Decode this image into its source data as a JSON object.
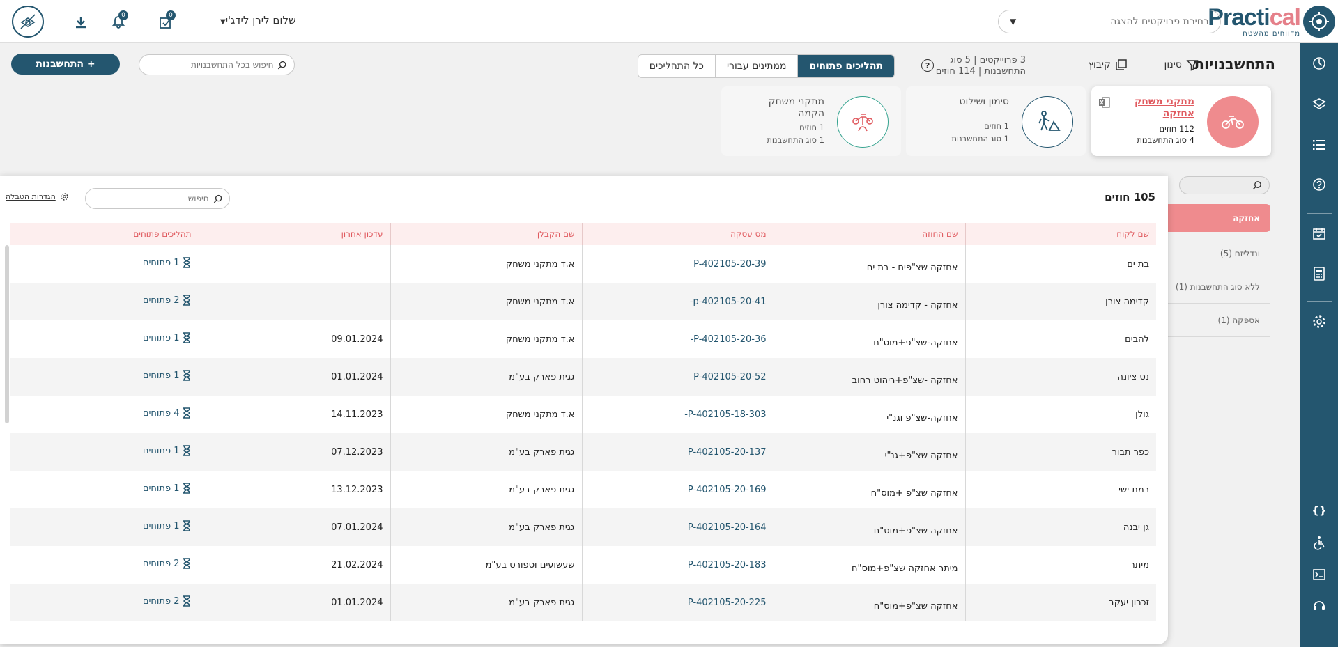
{
  "topbar": {
    "logo_word_main": "Practi",
    "logo_word_accent": "cal",
    "logo_sub": "מדווחים מהשטח",
    "project_select_placeholder": "בחירת פרויקטים להצגה",
    "greeting": "שלום לירן לידג'י",
    "tasks_count": "0",
    "notifications_count": "0"
  },
  "header": {
    "title": "התחשבנויות",
    "filter_label": "סינון",
    "group_label": "קיבוץ",
    "stats_line1": "3 פרוייקטים | 5 סוג",
    "stats_line2": "התחשבנות | 114 חוזים",
    "tabs": [
      {
        "label": "תהליכים פתוחים",
        "active": true
      },
      {
        "label": "ממתינים עבורי",
        "active": false
      },
      {
        "label": "כל התהליכים",
        "active": false
      }
    ],
    "global_search_placeholder": "חיפוש בכל התחשבנויות",
    "add_button_label": "+ התחשבנות"
  },
  "cards": [
    {
      "title": "מתקני משחק אחזקה",
      "contracts": "112 חוזים",
      "types": "4 סוג התחשבנות",
      "selected": true
    },
    {
      "title": "סימון ושילוט",
      "contracts": "1 חוזים",
      "types": "1 סוג התחשבנות",
      "selected": false
    },
    {
      "title": "מתקני משחק הקמה",
      "contracts": "1 חוזים",
      "types": "1 סוג התחשבנות",
      "selected": false
    }
  ],
  "sidelist": {
    "active_label": "אחזקה",
    "items": [
      {
        "label": "ונדליזם (5)"
      },
      {
        "label": "ללא סוג התחשבנות (1)"
      },
      {
        "label": "אספקה (1)"
      }
    ]
  },
  "panel": {
    "title": "105 חוזים",
    "search_placeholder": "חיפוש",
    "settings_label": "הגדרות הטבלה"
  },
  "table": {
    "columns": [
      "שם לקוח",
      "שם החוזה",
      "מס עסקה",
      "שם הקבלן",
      "עדכון אחרון",
      "תהליכים פתוחים"
    ],
    "rows": [
      {
        "client": "בת ים",
        "contract": "אחזקה שצ\"פים - בת ים",
        "deal": "P-402105-20-39",
        "contractor": "א.ד מתקני משחק",
        "updated": "",
        "open": "1 פתוחים"
      },
      {
        "client": "קדימה צורן",
        "contract": "אחזקה - קדימה צורן",
        "deal": "p-402105-20-41-",
        "contractor": "א.ד מתקני משחק",
        "updated": "",
        "open": "2 פתוחים"
      },
      {
        "client": "להבים",
        "contract": "אחזקה-שצ\"פ+מוס\"ח",
        "deal": "P-402105-20-36-",
        "contractor": "א.ד מתקני משחק",
        "updated": "09.01.2024",
        "open": "1 פתוחים"
      },
      {
        "client": "נס ציונה",
        "contract": "אחזקה -שצ\"פ+ריהוט רחוב",
        "deal": "P-402105-20-52",
        "contractor": "גגית פארק בע\"מ",
        "updated": "01.01.2024",
        "open": "1 פתוחים"
      },
      {
        "client": "גולן",
        "contract": "אחזקה-שצ\"פ וגנ\"י",
        "deal": "P-402105-18-303-",
        "contractor": "א.ד מתקני משחק",
        "updated": "14.11.2023",
        "open": "4 פתוחים"
      },
      {
        "client": "כפר תבור",
        "contract": "אחזקה שצ\"פ+גנ\"י",
        "deal": "P-402105-20-137",
        "contractor": "גגית פארק בע\"מ",
        "updated": "07.12.2023",
        "open": "1 פתוחים"
      },
      {
        "client": "רמת ישי",
        "contract": "אחזקה שצ\"פ +מוס\"ח",
        "deal": "P-402105-20-169",
        "contractor": "גגית פארק בע\"מ",
        "updated": "13.12.2023",
        "open": "1 פתוחים"
      },
      {
        "client": "גן יבנה",
        "contract": "אחזקה שצ\"פ+מוס\"ח",
        "deal": "P-402105-20-164",
        "contractor": "גגית פארק בע\"מ",
        "updated": "07.01.2024",
        "open": "1 פתוחים"
      },
      {
        "client": "מיתר",
        "contract": "מיתר אחזקה שצ\"פ+מוס\"ח",
        "deal": "P-402105-20-183",
        "contractor": "שעשועים וספורט בע\"מ",
        "updated": "21.02.2024",
        "open": "2 פתוחים"
      },
      {
        "client": "זכרון יעקב",
        "contract": "אחזקה שצ\"פ+מוס\"ח",
        "deal": "P-402105-20-225",
        "contractor": "גגית פארק בע\"מ",
        "updated": "01.01.2024",
        "open": "2 פתוחים"
      }
    ]
  },
  "colors": {
    "brand": "#24566f",
    "accent": "#ef8b8e",
    "accent_text": "#e05a5f"
  },
  "icons": {
    "rail": [
      "dashboard-icon",
      "map-pin-icon",
      "list-icon",
      "help-icon",
      "calendar-check-icon",
      "calculator-icon",
      "settings-icon",
      "code-icon",
      "accessibility-icon",
      "terminal-icon",
      "support-icon"
    ]
  }
}
